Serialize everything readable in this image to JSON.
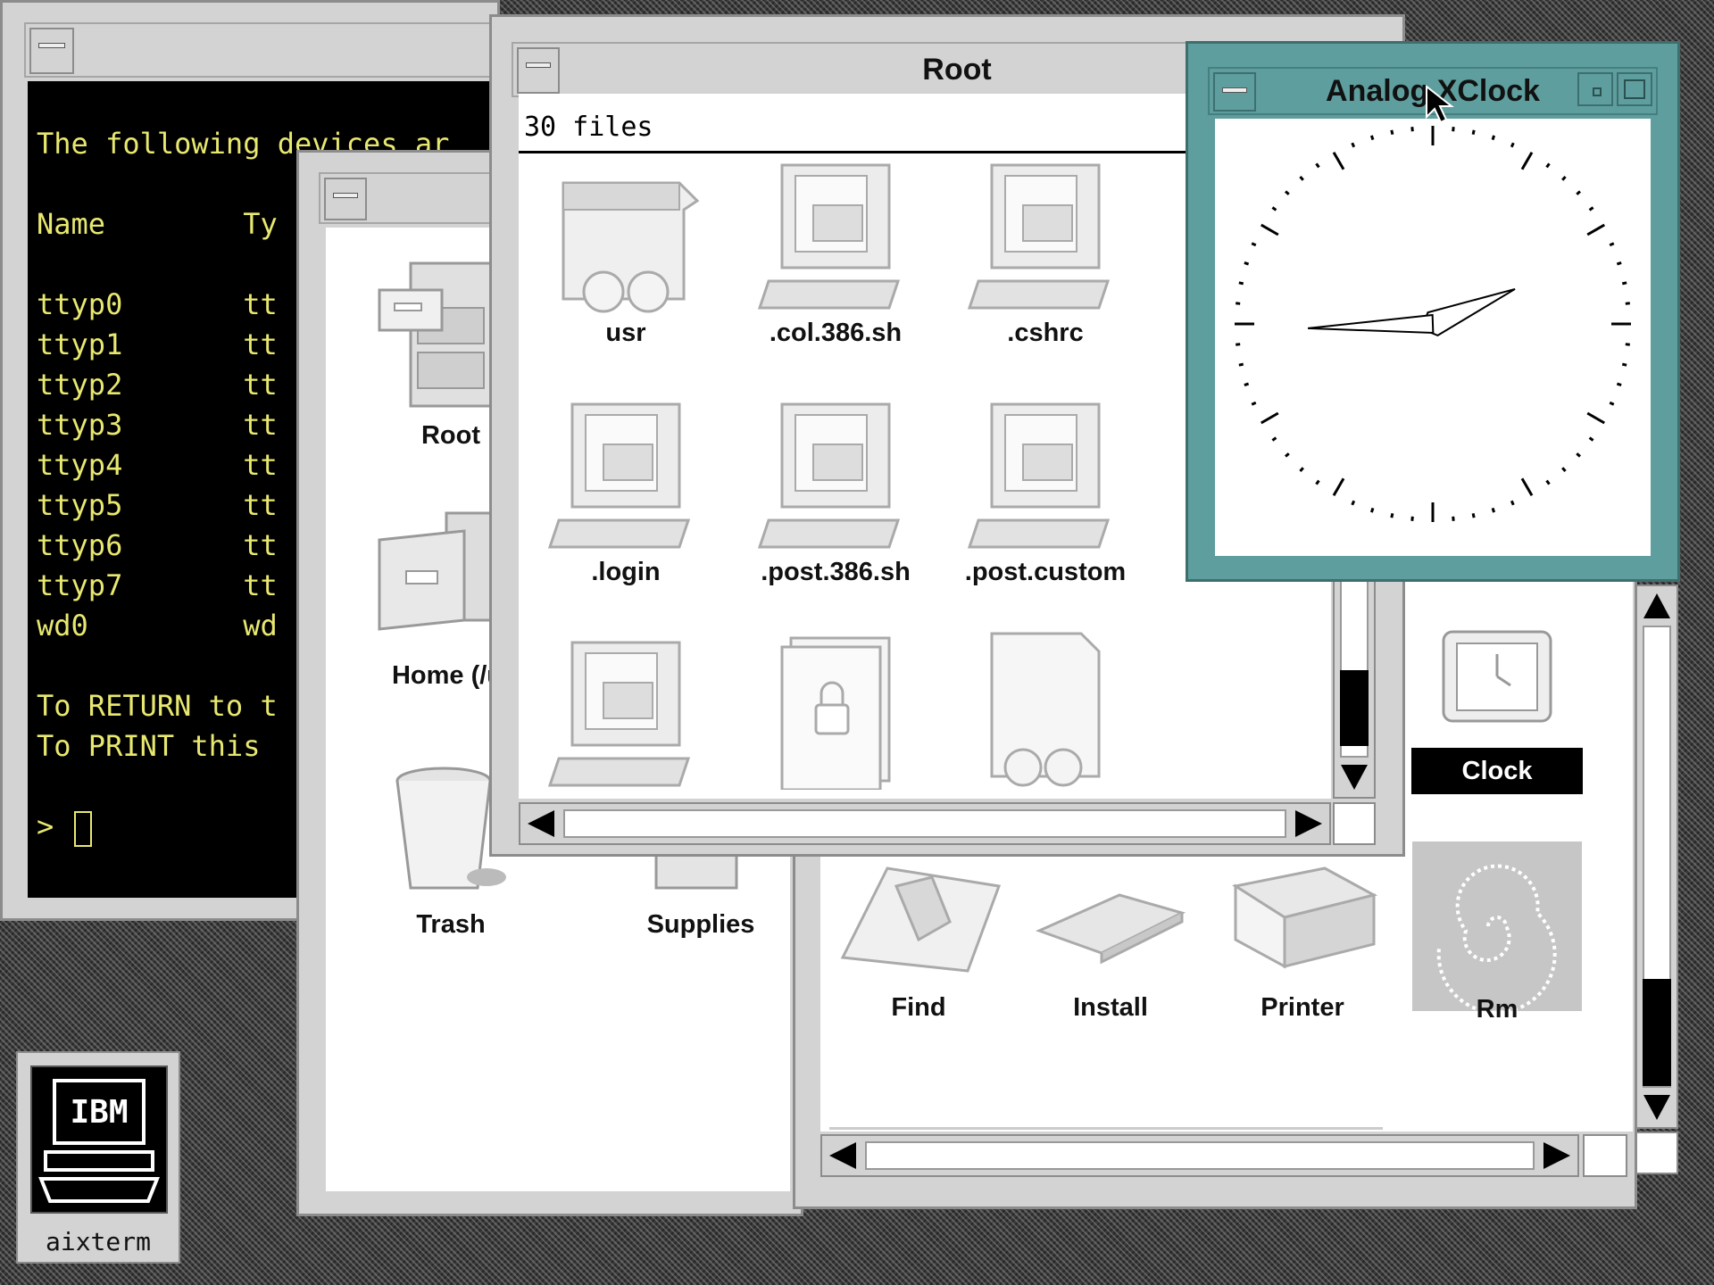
{
  "terminal_window": {
    "lines": [
      "The following devices ar",
      "",
      "Name        Ty",
      "",
      "ttyp0       tt",
      "ttyp1       tt",
      "ttyp2       tt",
      "ttyp3       tt",
      "ttyp4       tt",
      "ttyp5       tt",
      "ttyp6       tt",
      "ttyp7       tt",
      "wd0         wd",
      "",
      "To RETURN to t",
      "To PRINT this",
      "",
      "> "
    ]
  },
  "home_window": {
    "icons": [
      {
        "label": "Root",
        "icon": "file-cabinet-icon"
      },
      {
        "label": "Home (/u.",
        "icon": "drawer-icon"
      },
      {
        "label": "Trash",
        "icon": "trash-can-icon"
      },
      {
        "label": "Supplies",
        "icon": "supplies-cabinet-icon"
      }
    ]
  },
  "root_window": {
    "title": "Root",
    "status": "30 files",
    "icons": [
      {
        "label": "usr",
        "icon": "folder-glasses-icon"
      },
      {
        "label": ".col.386.sh",
        "icon": "computer-file-icon"
      },
      {
        "label": ".cshrc",
        "icon": "computer-file-icon"
      },
      {
        "label": ".login",
        "icon": "computer-file-icon"
      },
      {
        "label": ".post.386.sh",
        "icon": "computer-file-icon"
      },
      {
        "label": ".post.custom",
        "icon": "computer-file-icon"
      },
      {
        "label": "",
        "icon": "computer-file-icon"
      },
      {
        "label": "",
        "icon": "locked-document-icon"
      },
      {
        "label": "",
        "icon": "document-glasses-icon"
      }
    ]
  },
  "tools_window": {
    "icons": [
      {
        "label": "Clock",
        "icon": "clock-icon",
        "selected": true
      },
      {
        "label": "Find",
        "icon": "find-icon"
      },
      {
        "label": "Install",
        "icon": "floppy-disk-icon"
      },
      {
        "label": "Printer",
        "icon": "printer-icon"
      },
      {
        "label": "Rm",
        "icon": "galaxy-icon"
      }
    ]
  },
  "clock_window": {
    "title": "Analog XClock",
    "time": {
      "hour": 2,
      "minute": 14,
      "second": 40
    }
  },
  "desktop_icon": {
    "label": "aixterm",
    "icon_text": "IBM"
  },
  "colors": {
    "window_gray": "#d3d3d3",
    "active_teal": "#5f9e9e",
    "terminal_text": "#e8e870",
    "terminal_bg": "#000000"
  }
}
